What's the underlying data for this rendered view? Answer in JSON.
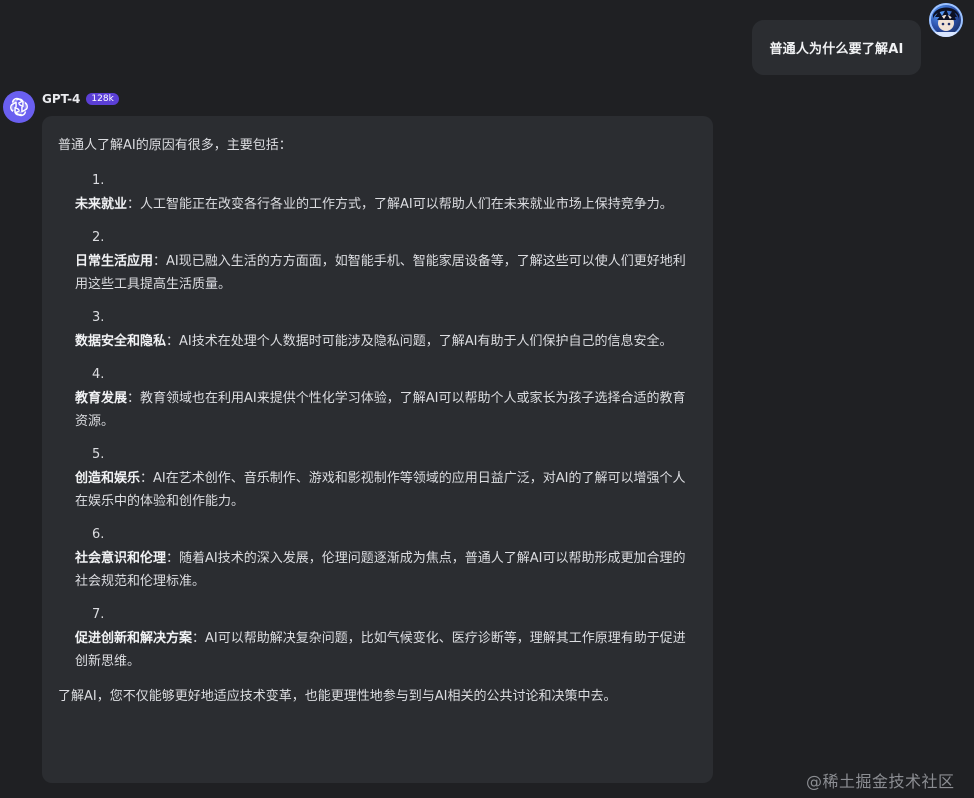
{
  "conversation": {
    "user_message": "普通人为什么要了解AI",
    "assistant": {
      "name": "GPT-4",
      "badge": "128k",
      "intro": "普通人了解AI的原因有很多，主要包括：",
      "items": [
        {
          "number": "1.",
          "title": "未来就业",
          "text": "：人工智能正在改变各行各业的工作方式，了解AI可以帮助人们在未来就业市场上保持竞争力。"
        },
        {
          "number": "2.",
          "title": "日常生活应用",
          "text": "：AI现已融入生活的方方面面，如智能手机、智能家居设备等，了解这些可以使人们更好地利用这些工具提高生活质量。"
        },
        {
          "number": "3.",
          "title": "数据安全和隐私",
          "text": "：AI技术在处理个人数据时可能涉及隐私问题，了解AI有助于人们保护自己的信息安全。"
        },
        {
          "number": "4.",
          "title": "教育发展",
          "text": "：教育领域也在利用AI来提供个性化学习体验，了解AI可以帮助个人或家长为孩子选择合适的教育资源。"
        },
        {
          "number": "5.",
          "title": "创造和娱乐",
          "text": "：AI在艺术创作、音乐制作、游戏和影视制作等领域的应用日益广泛，对AI的了解可以增强个人在娱乐中的体验和创作能力。"
        },
        {
          "number": "6.",
          "title": "社会意识和伦理",
          "text": "：随着AI技术的深入发展，伦理问题逐渐成为焦点，普通人了解AI可以帮助形成更加合理的社会规范和伦理标准。"
        },
        {
          "number": "7.",
          "title": "促进创新和解决方案",
          "text": "：AI可以帮助解决复杂问题，比如气候变化、医疗诊断等，理解其工作原理有助于促进创新思维。"
        }
      ],
      "outro": "了解AI，您不仅能够更好地适应技术变革，也能更理性地参与到与AI相关的公共讨论和决策中去。"
    }
  },
  "watermark": "@稀土掘金技术社区",
  "icons": {
    "assistant_avatar": "openai-logo-icon",
    "user_avatar": "user-avatar-icon"
  },
  "colors": {
    "background": "#1f2023",
    "bubble": "#2b2d31",
    "badge": "#5b3fd6",
    "assistant_avatar": "#6a5ff0"
  }
}
